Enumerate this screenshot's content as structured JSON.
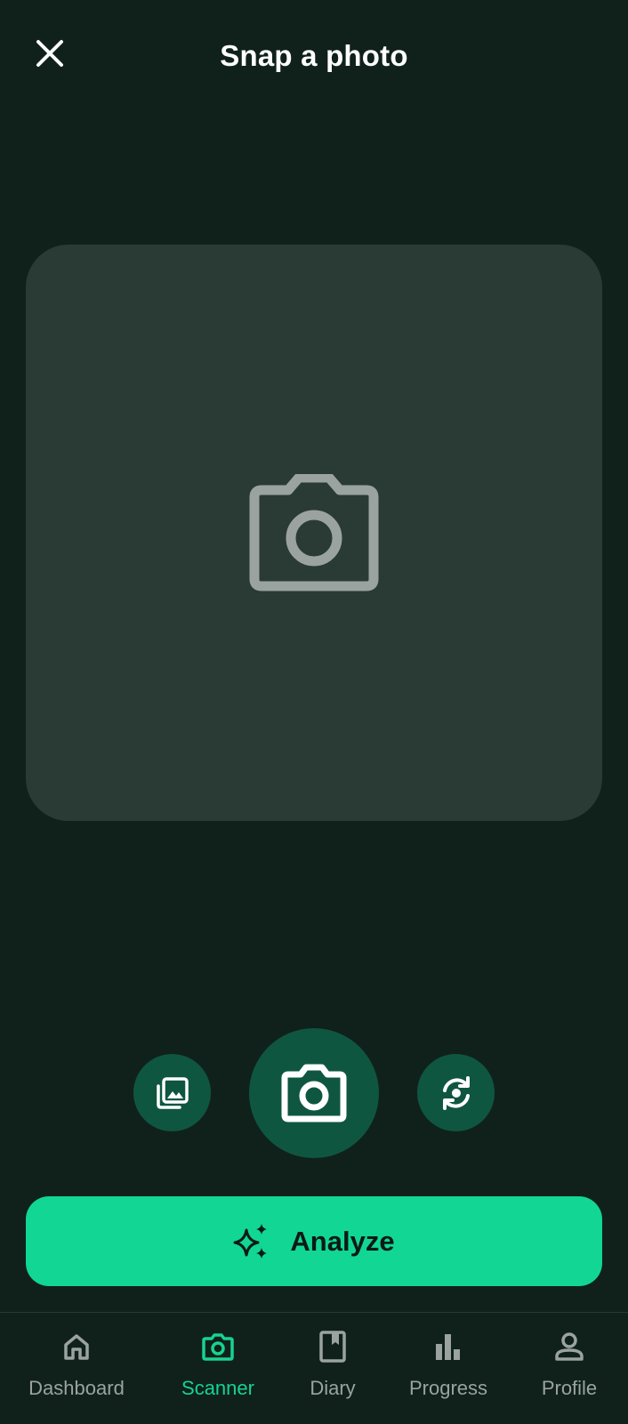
{
  "header": {
    "title": "Snap a photo",
    "close_icon": "close-icon"
  },
  "preview": {
    "placeholder_icon": "camera-icon"
  },
  "controls": {
    "gallery_icon": "gallery-icon",
    "capture_icon": "camera-icon",
    "flip_icon": "flip-camera-icon"
  },
  "analyze": {
    "label": "Analyze",
    "icon": "sparkles-icon"
  },
  "nav": {
    "items": [
      {
        "label": "Dashboard",
        "icon": "home-icon",
        "active": false
      },
      {
        "label": "Scanner",
        "icon": "camera-icon",
        "active": true
      },
      {
        "label": "Diary",
        "icon": "book-icon",
        "active": false
      },
      {
        "label": "Progress",
        "icon": "bar-chart-icon",
        "active": false
      },
      {
        "label": "Profile",
        "icon": "person-icon",
        "active": false
      }
    ]
  },
  "colors": {
    "background": "#10211c",
    "preview_background": "#2a3b36",
    "control_button": "#0f5640",
    "accent": "#12d694",
    "active_nav": "#18d291",
    "inactive_nav": "#9aa3a0"
  }
}
